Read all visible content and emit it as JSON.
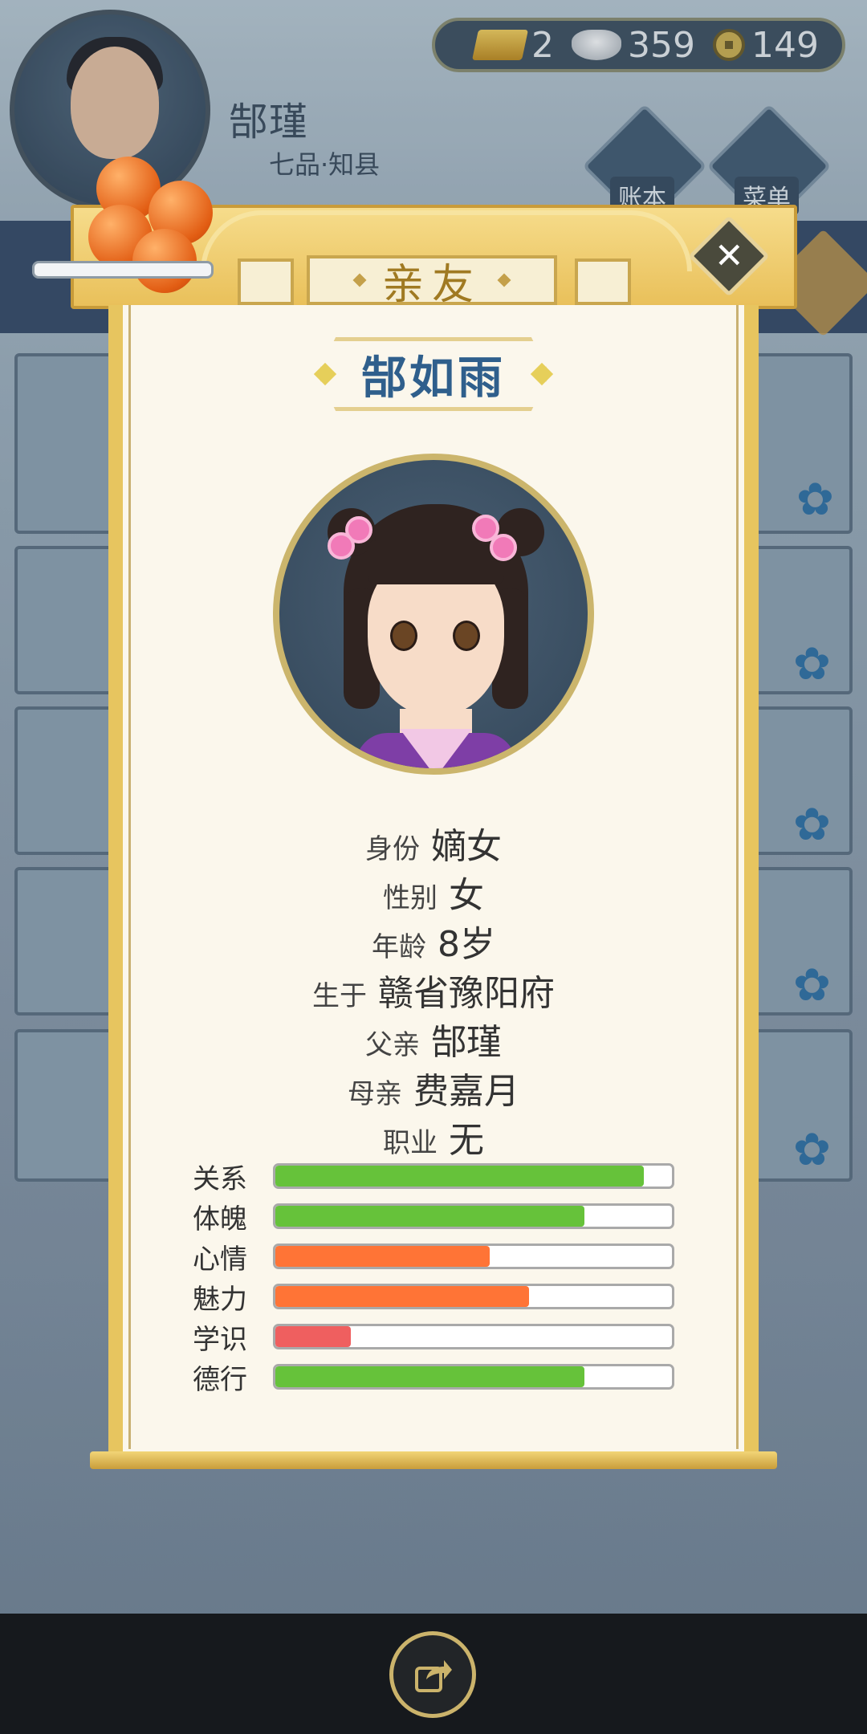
{
  "player": {
    "name": "郜瑾",
    "rank": "七品·知县"
  },
  "currency": {
    "gold": "2",
    "silver": "359",
    "coin": "149",
    "icons": [
      "gold-ingot-icon",
      "silver-ingot-icon",
      "copper-coin-icon"
    ]
  },
  "top_buttons": {
    "ledger": "账本",
    "menu": "菜单"
  },
  "modal": {
    "title": "亲友",
    "character_name": "郜如雨",
    "info": [
      {
        "label": "身份",
        "value": "嫡女"
      },
      {
        "label": "性别",
        "value": "女"
      },
      {
        "label": "年龄",
        "value": "8岁"
      },
      {
        "label": "生于",
        "value": "赣省豫阳府"
      },
      {
        "label": "父亲",
        "value": "郜瑾"
      },
      {
        "label": "母亲",
        "value": "费嘉月"
      },
      {
        "label": "职业",
        "value": "无"
      }
    ],
    "stats": [
      {
        "label": "关系",
        "fraction": 0.93,
        "color": "#66c23a"
      },
      {
        "label": "体魄",
        "fraction": 0.78,
        "color": "#66c23a"
      },
      {
        "label": "心情",
        "fraction": 0.54,
        "color": "#ff7436"
      },
      {
        "label": "魅力",
        "fraction": 0.64,
        "color": "#ff7436"
      },
      {
        "label": "学识",
        "fraction": 0.19,
        "color": "#ef5f5f"
      },
      {
        "label": "德行",
        "fraction": 0.78,
        "color": "#66c23a"
      }
    ]
  },
  "colors": {
    "accent_gold": "#e7c55f",
    "name_blue": "#2f5f8c"
  }
}
